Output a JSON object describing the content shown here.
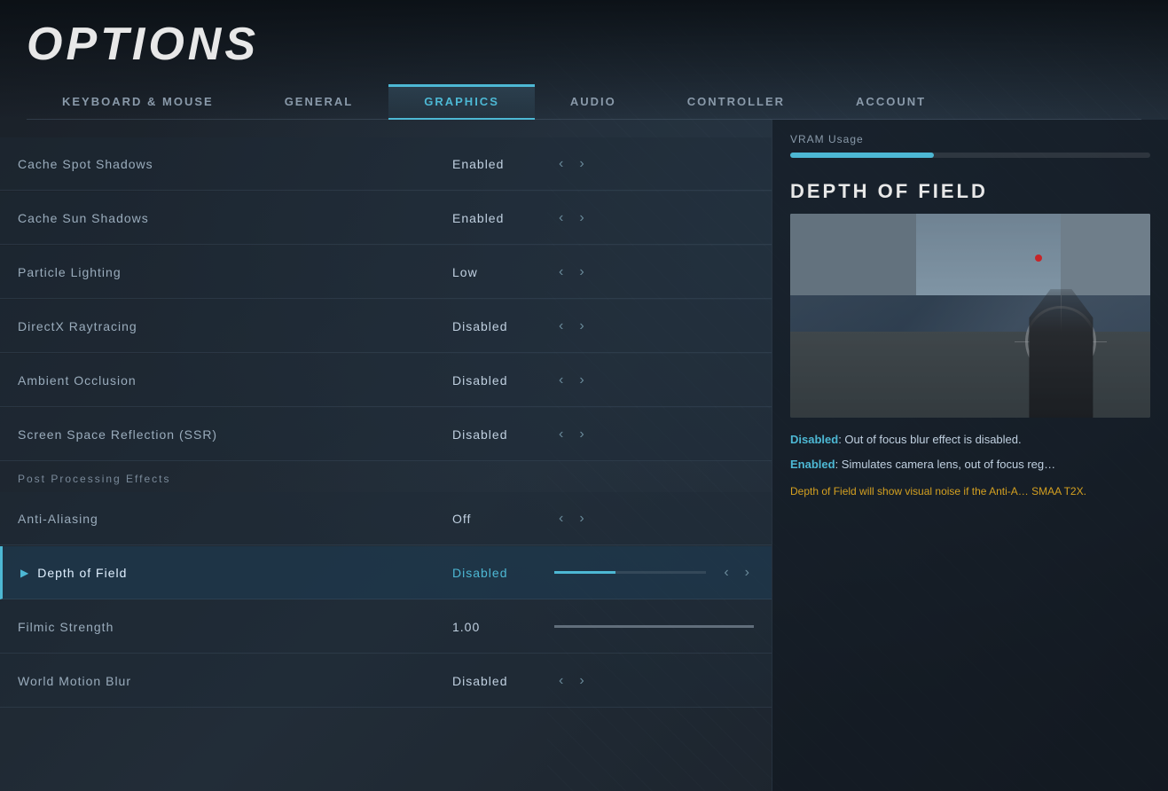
{
  "page": {
    "title": "OPTIONS"
  },
  "nav": {
    "tabs": [
      {
        "id": "keyboard-mouse",
        "label": "KEYBOARD & MOUSE",
        "active": false
      },
      {
        "id": "general",
        "label": "GENERAL",
        "active": false
      },
      {
        "id": "graphics",
        "label": "GRAPHICS",
        "active": true
      },
      {
        "id": "audio",
        "label": "AUDIO",
        "active": false
      },
      {
        "id": "controller",
        "label": "CONTROLLER",
        "active": false
      },
      {
        "id": "account",
        "label": "ACCOUNT",
        "active": false
      }
    ]
  },
  "settings": {
    "section_label": "Post Processing Effects",
    "rows": [
      {
        "id": "cache-spot-shadows",
        "label": "Cache Spot Shadows",
        "value": "Enabled",
        "active": false,
        "has_arrows": true,
        "has_progress": false,
        "has_play": false
      },
      {
        "id": "cache-sun-shadows",
        "label": "Cache Sun Shadows",
        "value": "Enabled",
        "active": false,
        "has_arrows": true,
        "has_progress": false,
        "has_play": false
      },
      {
        "id": "particle-lighting",
        "label": "Particle Lighting",
        "value": "Low",
        "active": false,
        "has_arrows": true,
        "has_progress": false,
        "has_play": false
      },
      {
        "id": "directx-raytracing",
        "label": "DirectX Raytracing",
        "value": "Disabled",
        "active": false,
        "has_arrows": true,
        "has_progress": false,
        "has_play": false
      },
      {
        "id": "ambient-occlusion",
        "label": "Ambient Occlusion",
        "value": "Disabled",
        "active": false,
        "has_arrows": true,
        "has_progress": false,
        "has_play": false
      },
      {
        "id": "screen-space-reflection",
        "label": "Screen Space Reflection (SSR)",
        "value": "Disabled",
        "active": false,
        "has_arrows": true,
        "has_progress": false,
        "has_play": false
      }
    ],
    "post_processing_rows": [
      {
        "id": "anti-aliasing",
        "label": "Anti-Aliasing",
        "value": "Off",
        "active": false,
        "has_arrows": true,
        "has_progress": false,
        "has_play": false
      },
      {
        "id": "depth-of-field",
        "label": "Depth of Field",
        "value": "Disabled",
        "active": true,
        "has_arrows": true,
        "has_progress": true,
        "progress": 40,
        "has_play": true
      },
      {
        "id": "filmic-strength",
        "label": "Filmic Strength",
        "value": "1.00",
        "active": false,
        "has_arrows": false,
        "has_progress": true,
        "progress": 100,
        "has_play": false
      },
      {
        "id": "world-motion-blur",
        "label": "World Motion Blur",
        "value": "Disabled",
        "active": false,
        "has_arrows": true,
        "has_progress": false,
        "has_play": false
      }
    ]
  },
  "info_panel": {
    "vram": {
      "label": "VRAM Usage",
      "fill_percent": 40
    },
    "dof_title": "DEPTH OF FIELD",
    "description_disabled_status": "Disabled",
    "description_disabled_text": ": Out of focus blur effect is disabled.",
    "description_enabled_status": "Enabled",
    "description_enabled_text": ": Simulates camera lens, out of focus reg…",
    "warning_text": "Depth of Field will show visual noise if the Anti-A… SMAA T2X."
  },
  "icons": {
    "left_arrow": "‹",
    "right_arrow": "›",
    "play": "▶"
  }
}
